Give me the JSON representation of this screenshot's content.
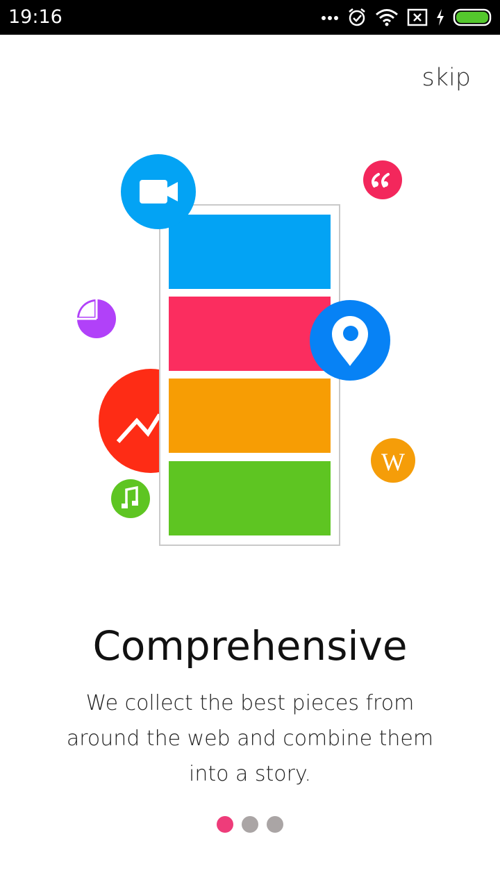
{
  "status_bar": {
    "time": "19:16",
    "icons": [
      "more-dots-icon",
      "alarm-icon",
      "wifi-icon",
      "sim-off-icon",
      "charging-icon",
      "battery-icon"
    ]
  },
  "skip_label": "skip",
  "illustration": {
    "icons": [
      "video-camera-icon",
      "quote-icon",
      "pie-chart-icon",
      "trend-chart-icon",
      "location-pin-icon",
      "wikipedia-icon",
      "music-note-icon"
    ],
    "colors": {
      "blue": "#03a3f4",
      "pink": "#fb2d5f",
      "orange": "#f79d04",
      "green": "#5ec522",
      "purple": "#b141f9",
      "red": "#fe2c15",
      "pin_blue": "#0782f5",
      "wiki_orange": "#f59d09",
      "quote_pink": "#f3275c"
    },
    "wiki_letter": "W"
  },
  "onboarding": {
    "title": "Comprehensive",
    "description": "We collect the best pieces from around the web and combine them into a story."
  },
  "pager": {
    "page_count": 3,
    "active_index": 0
  }
}
